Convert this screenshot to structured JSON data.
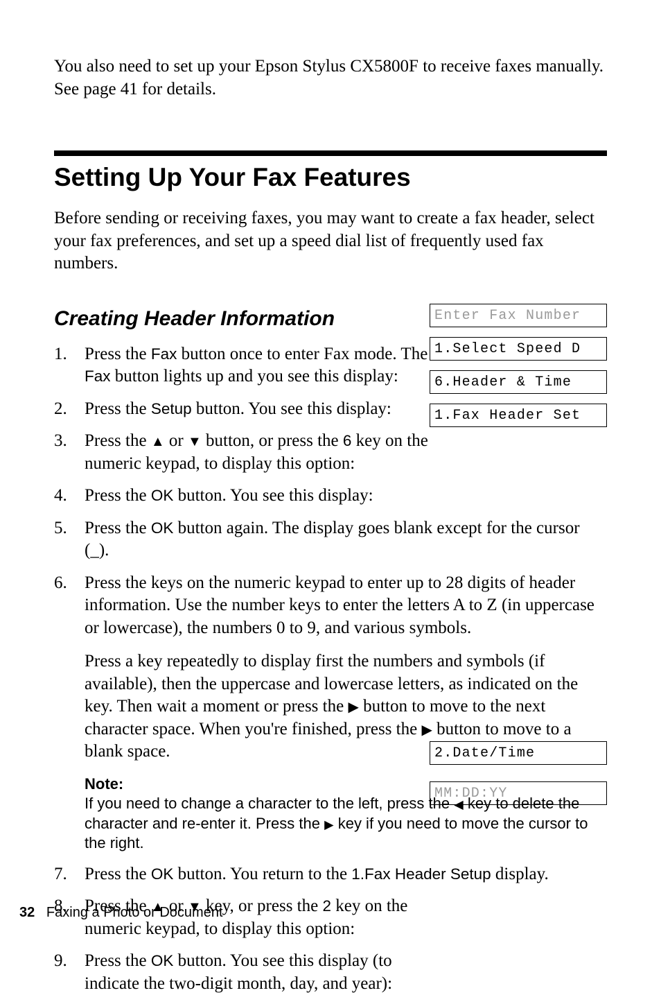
{
  "intro": "You also need to set up your Epson Stylus CX5800F to receive faxes manually. See page 41 for details.",
  "section_title": "Setting Up Your Fax Features",
  "section_intro": "Before sending or receiving faxes, you may want to create a fax header, select your fax preferences, and set up a speed dial list of frequently used fax numbers.",
  "subsection_title": "Creating Header Information",
  "steps": {
    "s1a": "Press the ",
    "s1b": " button once to enter Fax mode. The ",
    "s1c": " button lights up and you see this display:",
    "s2a": "Press the ",
    "s2b": " button. You see this display:",
    "s3a": "Press the ",
    "s3b": " or ",
    "s3c": " button, or press the ",
    "s3d": " key on the numeric keypad, to display this option:",
    "s4a": "Press the ",
    "s4b": " button. You see this display:",
    "s5a": "Press the ",
    "s5b": " button again. The display goes blank except for the cursor (_).",
    "s6a": "Press the keys on the numeric keypad to enter up to 28 digits of header information. Use the number keys to enter the letters A to Z (in uppercase or lowercase), the numbers 0 to 9, and various symbols.",
    "s6b1": "Press a key repeatedly to display first the numbers and symbols (if available), then the uppercase and lowercase letters, as indicated on the key. Then wait a moment or press the ",
    "s6b2": " button to move to the next character space. When you're finished, press the ",
    "s6b3": " button to move to a blank space.",
    "note_label": "Note:",
    "note1": "If you need to change a character to the left, press the ",
    "note2": " key to delete the character and re-enter it. Press the ",
    "note3": " key if you need to move the cursor to the right.",
    "s7a": "Press the ",
    "s7b": " button. You return to the ",
    "s7c": " display.",
    "s8a": "Press the ",
    "s8b": " or ",
    "s8c": " key, or press the ",
    "s8d": " key on the numeric keypad, to display this option:",
    "s9a": "Press the ",
    "s9b": " button. You see this display (to indicate the two-digit month, day, and year):"
  },
  "labels": {
    "fax": "Fax",
    "setup": "Setup",
    "six": "6",
    "two": "2",
    "ok": "OK",
    "fax_header_setup": "1.Fax Header Setup"
  },
  "glyphs": {
    "up": "▲",
    "down": "▼",
    "left": "◀",
    "right": "▶"
  },
  "lcd": {
    "l1": "Enter Fax Number",
    "l2": "1.Select Speed D",
    "l3": "6.Header & Time",
    "l4": "1.Fax Header Set",
    "l5": "2.Date/Time",
    "l6": "MM:DD:YY"
  },
  "footer": {
    "page": "32",
    "title": "Faxing a Photo or Document"
  }
}
